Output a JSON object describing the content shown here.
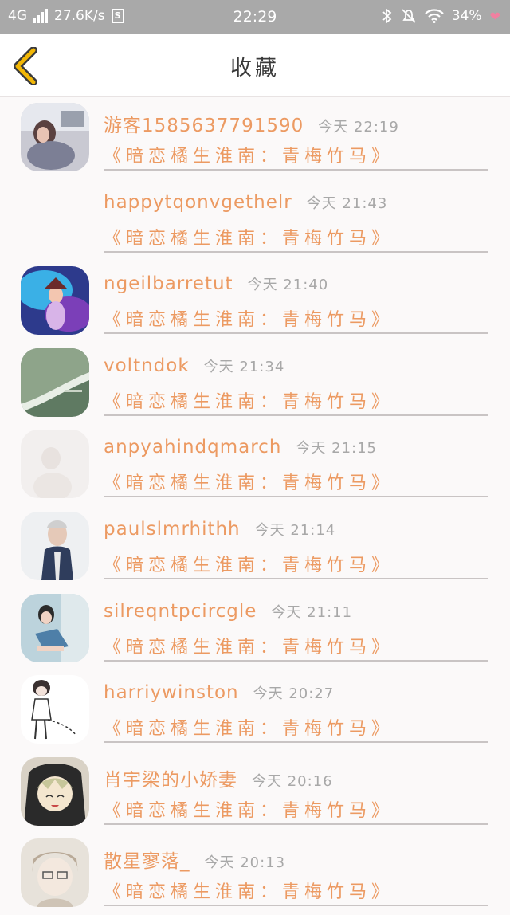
{
  "status_bar": {
    "network": "4G",
    "speed": "27.6K/s",
    "speed_icon_letter": "S",
    "time": "22:29",
    "battery": "34%",
    "icons": [
      "signal-icon",
      "speed-icon",
      "bluetooth-icon",
      "alarm-off-icon",
      "wifi-icon",
      "heart-icon"
    ]
  },
  "header": {
    "title": "收藏",
    "back_icon": "chevron-left-icon",
    "accent": "#f2b705"
  },
  "colors": {
    "name": "#ec9a62",
    "time": "#a8a8a8",
    "divider": "#c9c4c4"
  },
  "items": [
    {
      "username": "游客1585637791590",
      "time": "今天 22:19",
      "book": "《暗恋橘生淮南：青梅竹马》",
      "has_avatar": true
    },
    {
      "username": "happytqonvgethelr",
      "time": "今天 21:43",
      "book": "《暗恋橘生淮南：青梅竹马》",
      "has_avatar": false
    },
    {
      "username": "ngeilbarretut",
      "time": "今天 21:40",
      "book": "《暗恋橘生淮南：青梅竹马》",
      "has_avatar": true
    },
    {
      "username": "voltndok",
      "time": "今天 21:34",
      "book": "《暗恋橘生淮南：青梅竹马》",
      "has_avatar": true
    },
    {
      "username": "anpyahindqmarch",
      "time": "今天 21:15",
      "book": "《暗恋橘生淮南：青梅竹马》",
      "has_avatar": true
    },
    {
      "username": "paulslmrhithh",
      "time": "今天 21:14",
      "book": "《暗恋橘生淮南：青梅竹马》",
      "has_avatar": true
    },
    {
      "username": "silreqntpcircgle",
      "time": "今天 21:11",
      "book": "《暗恋橘生淮南：青梅竹马》",
      "has_avatar": true
    },
    {
      "username": "harriywinston",
      "time": "今天 20:27",
      "book": "《暗恋橘生淮南：青梅竹马》",
      "has_avatar": true
    },
    {
      "username": "肖宇梁的小娇妻",
      "time": "今天 20:16",
      "book": "《暗恋橘生淮南：青梅竹马》",
      "has_avatar": true
    },
    {
      "username": "散星寥落_",
      "time": "今天 20:13",
      "book": "《暗恋橘生淮南：青梅竹马》",
      "has_avatar": true
    }
  ]
}
